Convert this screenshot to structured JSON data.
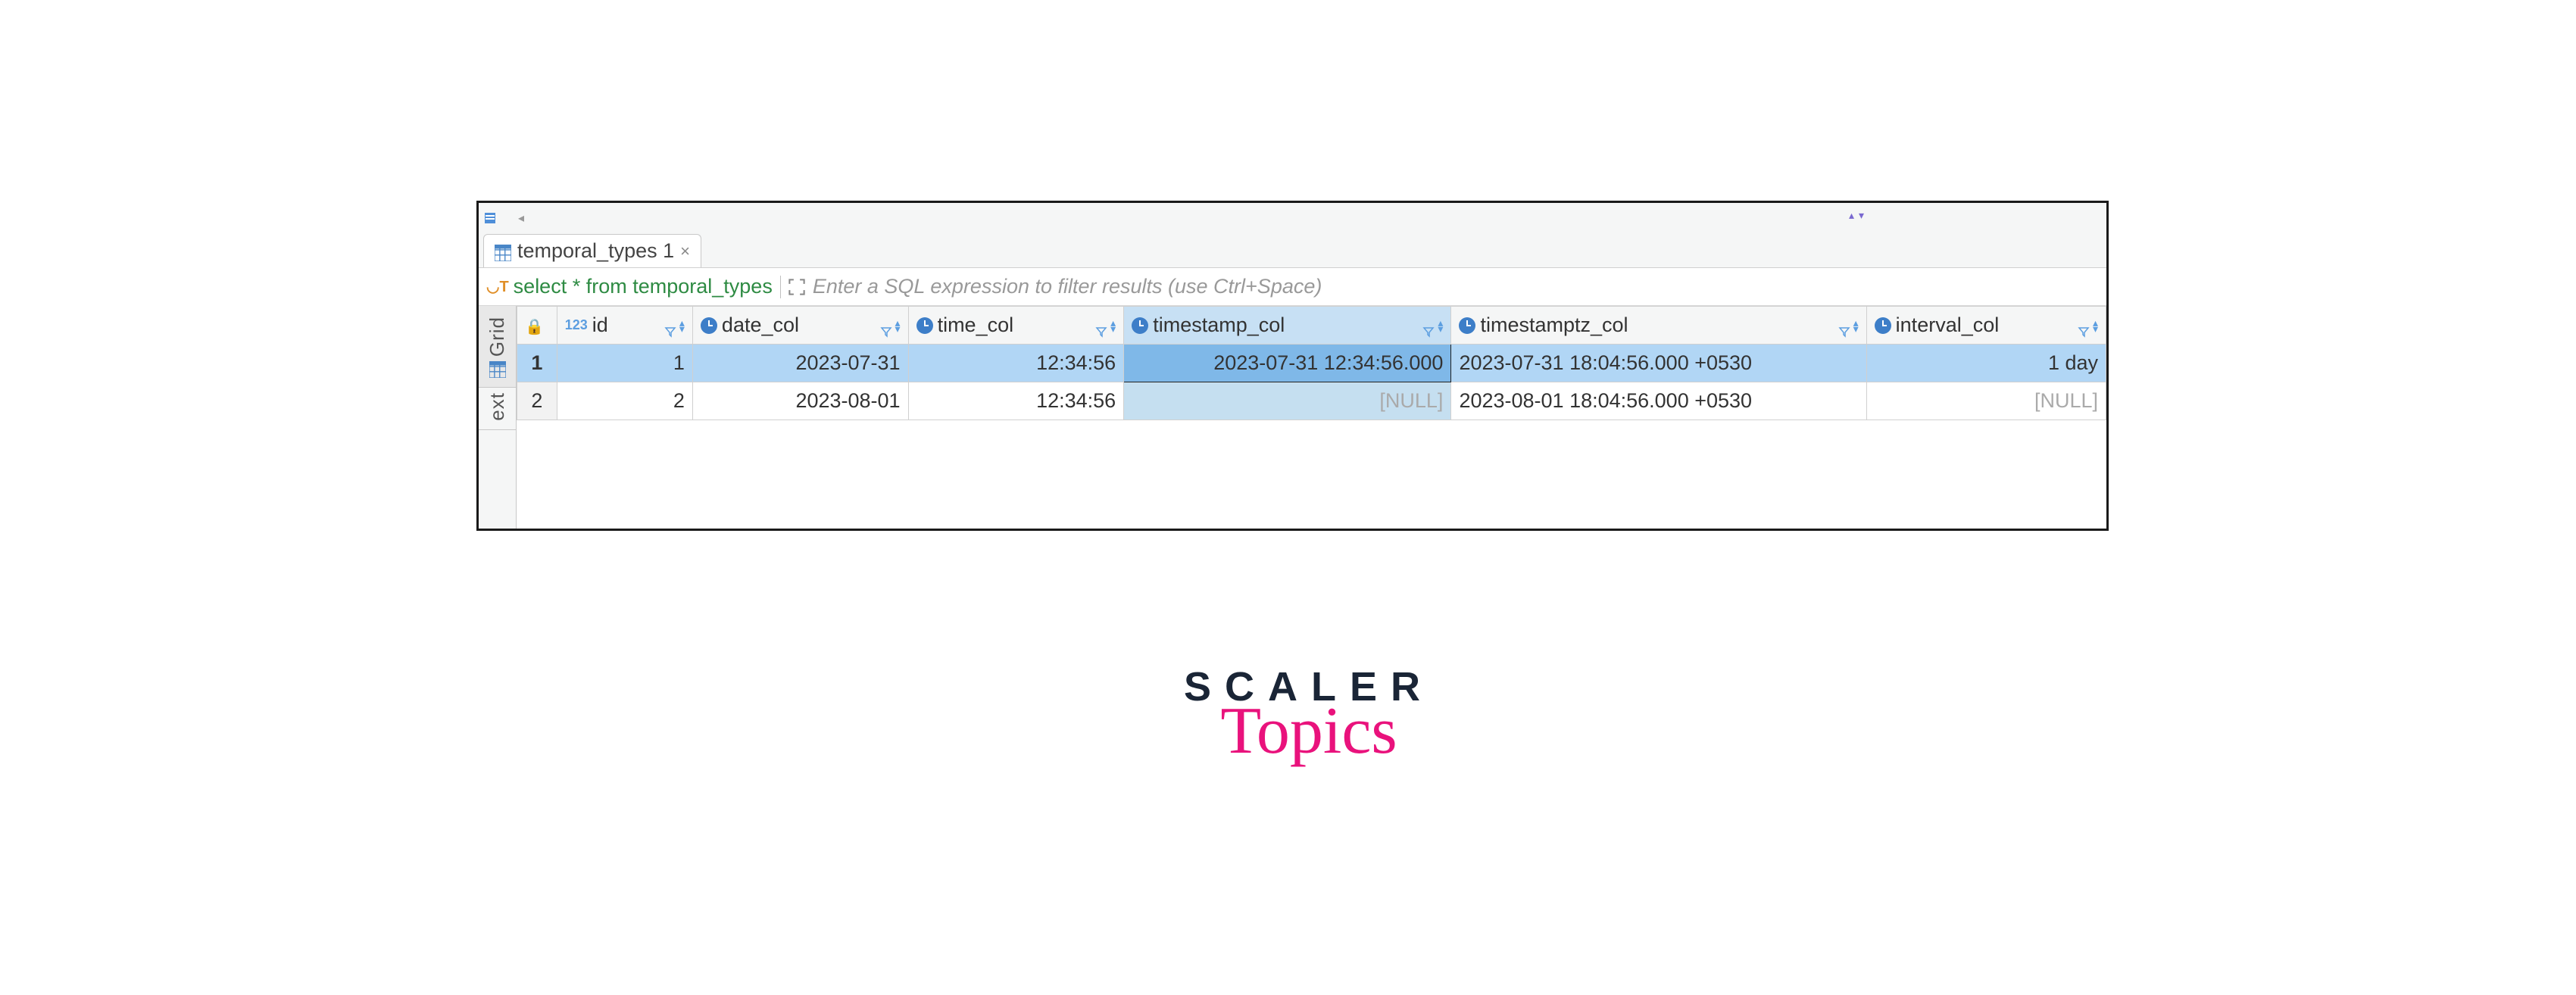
{
  "tab": {
    "title": "temporal_types 1"
  },
  "sql": {
    "query": "select * from temporal_types",
    "placeholder": "Enter a SQL expression to filter results (use Ctrl+Space)"
  },
  "sideTabs": {
    "grid": "Grid",
    "text": "ext"
  },
  "columns": {
    "id": "id",
    "date": "date_col",
    "time": "time_col",
    "timestamp": "timestamp_col",
    "timestamptz": "timestamptz_col",
    "interval": "interval_col"
  },
  "rows": [
    {
      "num": "1",
      "id": "1",
      "date": "2023-07-31",
      "time": "12:34:56",
      "timestamp": "2023-07-31 12:34:56.000",
      "timestamptz": "2023-07-31 18:04:56.000 +0530",
      "interval": "1 day"
    },
    {
      "num": "2",
      "id": "2",
      "date": "2023-08-01",
      "time": "12:34:56",
      "timestamp": "[NULL]",
      "timestamptz": "2023-08-01 18:04:56.000 +0530",
      "interval": "[NULL]"
    }
  ],
  "logo": {
    "top": "SCALER",
    "bottom": "Topics"
  }
}
